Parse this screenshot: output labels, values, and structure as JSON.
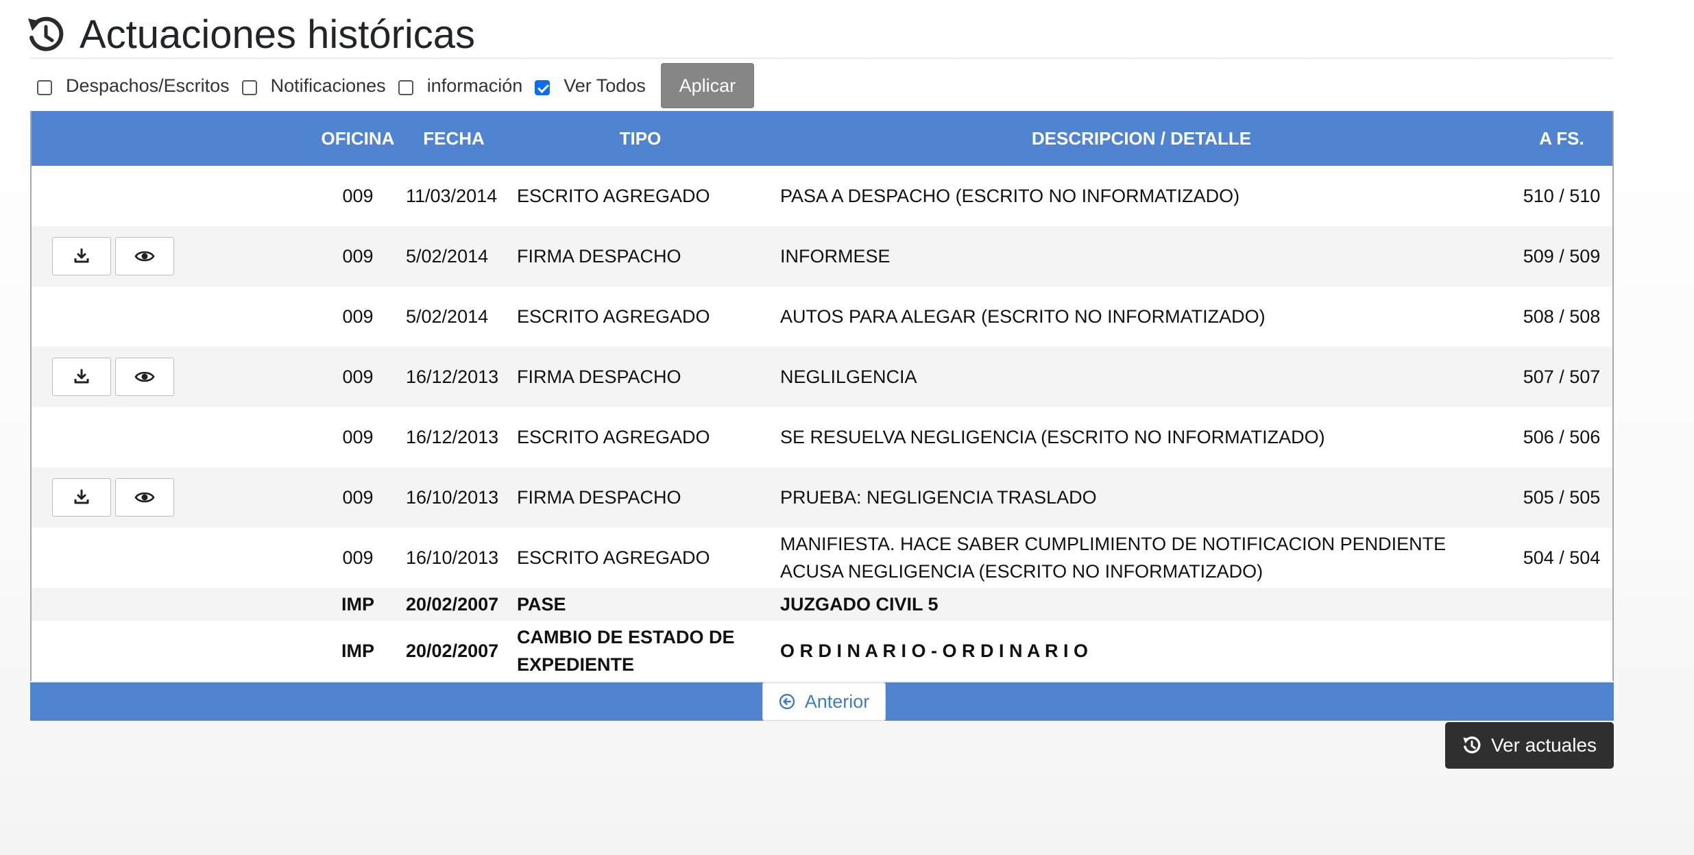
{
  "header": {
    "title": "Actuaciones históricas",
    "icon": "history-icon"
  },
  "filters": {
    "items": [
      {
        "label": "Despachos/Escritos",
        "checked": false
      },
      {
        "label": "Notificaciones",
        "checked": false
      },
      {
        "label": "información",
        "checked": false
      },
      {
        "label": "Ver Todos",
        "checked": true
      }
    ],
    "apply_label": "Aplicar"
  },
  "table": {
    "columns": [
      "OFICINA",
      "FECHA",
      "TIPO",
      "DESCRIPCION / DETALLE",
      "A FS."
    ],
    "rows": [
      {
        "office": "009",
        "date": "11/03/2014",
        "type": "ESCRITO AGREGADO",
        "description": "PASA A DESPACHO (ESCRITO NO INFORMATIZADO)",
        "fs": "510 / 510",
        "actions": false
      },
      {
        "office": "009",
        "date": "5/02/2014",
        "type": "FIRMA DESPACHO",
        "description": "INFORMESE",
        "fs": "509 / 509",
        "actions": true
      },
      {
        "office": "009",
        "date": "5/02/2014",
        "type": "ESCRITO AGREGADO",
        "description": "AUTOS PARA ALEGAR (ESCRITO NO INFORMATIZADO)",
        "fs": "508 / 508",
        "actions": false
      },
      {
        "office": "009",
        "date": "16/12/2013",
        "type": "FIRMA DESPACHO",
        "description": "NEGLILGENCIA",
        "fs": "507 / 507",
        "actions": true
      },
      {
        "office": "009",
        "date": "16/12/2013",
        "type": "ESCRITO AGREGADO",
        "description": "SE RESUELVA NEGLIGENCIA (ESCRITO NO INFORMATIZADO)",
        "fs": "506 / 506",
        "actions": false
      },
      {
        "office": "009",
        "date": "16/10/2013",
        "type": "FIRMA DESPACHO",
        "description": "PRUEBA: NEGLIGENCIA TRASLADO",
        "fs": "505 / 505",
        "actions": true
      },
      {
        "office": "009",
        "date": "16/10/2013",
        "type": "ESCRITO AGREGADO",
        "description": "MANIFIESTA. HACE SABER CUMPLIMIENTO DE NOTIFICACION PENDIENTE ACUSA NEGLIGENCIA (ESCRITO NO INFORMATIZADO)",
        "fs": "504 / 504",
        "actions": false
      },
      {
        "office": "IMP",
        "date": "20/02/2007",
        "type": "PASE",
        "description": "JUZGADO CIVIL 5",
        "fs": "",
        "actions": false
      },
      {
        "office": "IMP",
        "date": "20/02/2007",
        "type": "CAMBIO DE ESTADO DE EXPEDIENTE",
        "description": "O R D I N A R I O - O R D I N A R I O",
        "fs": "",
        "actions": false
      }
    ]
  },
  "pagination": {
    "prev_label": "Anterior"
  },
  "footer": {
    "current_label": "Ver actuales"
  },
  "colors": {
    "accent": "#5084d0",
    "apply_button": "#868686",
    "dark_button": "#2f2f2f",
    "link": "#3f7bc7"
  }
}
